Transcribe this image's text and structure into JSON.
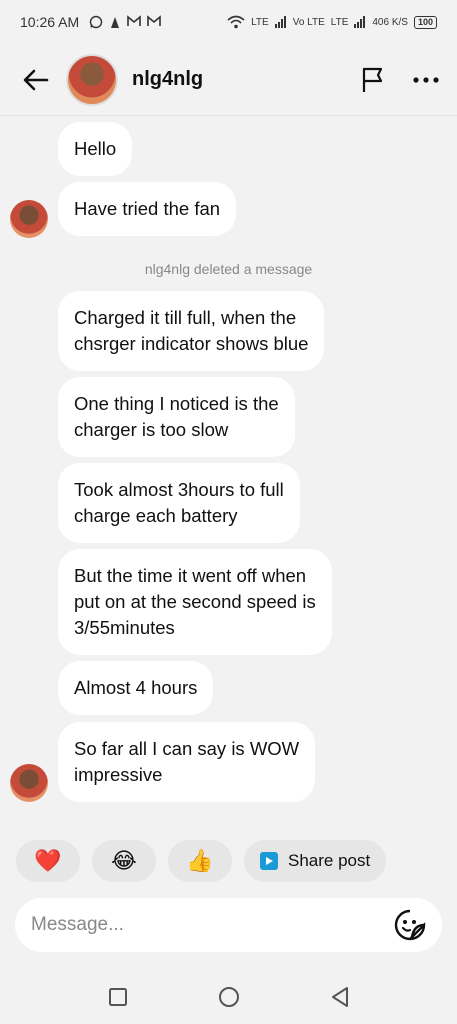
{
  "status_bar": {
    "time": "10:26 AM",
    "left_icons": [
      "whatsapp-icon",
      "app-icon",
      "gmail-icon",
      "gmail-icon"
    ],
    "network_1": "LTE",
    "volte": "Vo LTE",
    "network_2": "LTE",
    "speed": "406 K/S",
    "battery": "100"
  },
  "header": {
    "username": "nlg4nlg",
    "icons": [
      "back-arrow-icon",
      "flag-icon",
      "more-icon"
    ]
  },
  "messages": [
    {
      "text": "Hello"
    },
    {
      "text": "Have tried the fan"
    },
    {
      "text": "Charged it till full, when the\nchsrger indicator shows blue"
    },
    {
      "text": "One thing I noticed is the\ncharger is too slow"
    },
    {
      "text": "Took almost 3hours to full\ncharge each battery"
    },
    {
      "text": "But the time it went off when\nput on at the second speed is\n3/55minutes"
    },
    {
      "text": "Almost 4 hours"
    },
    {
      "text": "So far all I can say is WOW\nimpressive"
    }
  ],
  "system_message": "nlg4nlg deleted a message",
  "reactions": {
    "heart": "❤️",
    "laugh": "😂",
    "thumbs_up": "👍",
    "share_label": "Share post"
  },
  "composer": {
    "placeholder": "Message..."
  },
  "colors": {
    "background": "#f2f2f2",
    "bubble": "#ffffff",
    "reaction_bg": "#e6e6e6",
    "share_icon": "#1c9ad6"
  }
}
